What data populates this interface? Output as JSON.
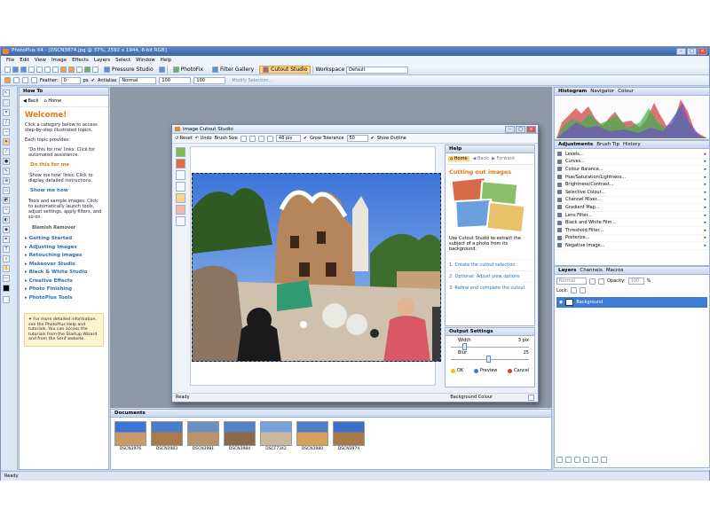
{
  "window": {
    "title": "PhotoPlus X4 - [DSCN3874.jpg @ 37%, 2592 x 1944, 8-bit RGB]"
  },
  "menu": [
    "File",
    "Edit",
    "View",
    "Image",
    "Effects",
    "Layers",
    "Select",
    "Window",
    "Help"
  ],
  "toolbar1": {
    "pressure_studio": "Pressure Studio",
    "photofix": "PhotoFix",
    "filter_gallery": "Filter Gallery",
    "cutout_studio": "Cutout Studio",
    "workspace_label": "Workspace",
    "workspace_value": "Default"
  },
  "toolbar2": {
    "feather_label": "Feather:",
    "feather_value": "0",
    "feather_unit": "px",
    "antialias": "Antialias",
    "mode_value": "Normal",
    "w_value": "100",
    "h_value": "100",
    "modify_selection": "Modify Selection..."
  },
  "howto": {
    "title": "How To",
    "back": "Back",
    "home": "Home",
    "welcome": "Welcome!",
    "intro": "Click a category below to access step-by-step illustrated topics.",
    "each": "Each topic provides:",
    "dothis_desc": "'Do this for me' links: Click for automated assistance.",
    "dothis_link": "Do this for me",
    "showme_desc": "'Show me how' links: Click to display detailed instructions.",
    "showme_link": "Show me how",
    "tools_desc": "Tools and sample images: Click to automatically launch tools, adjust settings, apply filters, and so on.",
    "blemish": "Blemish Remover",
    "categories": [
      "Getting Started",
      "Adjusting Images",
      "Retouching Images",
      "Makeover Studio",
      "Black & White Studio",
      "Creative Effects",
      "Photo Finishing",
      "PhotoPlus Tools"
    ],
    "note": "For more detailed information, see the PhotoPlus Help and tutorials. You can access the tutorials from the Startup Wizard and from the Serif website."
  },
  "documents": {
    "title": "Documents",
    "items": [
      "DSCN3976",
      "DSCN3983",
      "DSCN3981",
      "DSCN3984",
      "DSCF7342",
      "DSCN3980",
      "DSCN3974"
    ]
  },
  "right": {
    "tabs_top": [
      "Histogram",
      "Navigator",
      "Colour"
    ],
    "tabs_adj": [
      "Adjustments",
      "Brush Tip",
      "History"
    ],
    "adjustments": [
      "Levels...",
      "Curves...",
      "Colour Balance...",
      "Hue/Saturation/Lightness...",
      "Brightness/Contrast...",
      "Selective Colour...",
      "Channel Mixer...",
      "Gradient Map...",
      "Lens Filter...",
      "Black and White Film...",
      "Threshold Filter...",
      "Posterize...",
      "Negative Image..."
    ],
    "tabs_layers": [
      "Layers",
      "Channels",
      "Macros"
    ],
    "blend_mode": "Normal",
    "opacity_label": "Opacity:",
    "opacity_value": "100",
    "opacity_unit": "%",
    "lock_label": "Lock:",
    "layer_name": "Background"
  },
  "dialog": {
    "title": "Image Cutout Studio",
    "reset": "Reset",
    "undo": "Undo",
    "brush_size": "Brush Size",
    "brush_value": "48 pix",
    "grow_tolerance": "Grow Tolerance",
    "grow_value": "50",
    "show_outline": "Show Outline",
    "help_tab": "Help",
    "home": "Home",
    "back": "Back",
    "forward": "Forward",
    "heading": "Cutting out images",
    "help_text": "Use Cutout Studio to extract the subject of a photo from its background.",
    "steps": [
      "1: Create the cutout selection",
      "2: Optional: Adjust view options",
      "3: Refine and complete the cutout"
    ],
    "output_title": "Output Settings",
    "width_label": "Width",
    "width_value": "3 pix",
    "width_level": 0.15,
    "blur_label": "Blur",
    "blur_value": "25",
    "blur_level": 0.45,
    "ok": "OK",
    "preview": "Preview",
    "cancel": "Cancel",
    "status": "Ready",
    "bg_colour": "Background Colour"
  },
  "status": {
    "text": "Ready"
  },
  "colors": {
    "accent": "#e07a10",
    "link": "#2a6db4",
    "selection": "#3d7bd5"
  }
}
